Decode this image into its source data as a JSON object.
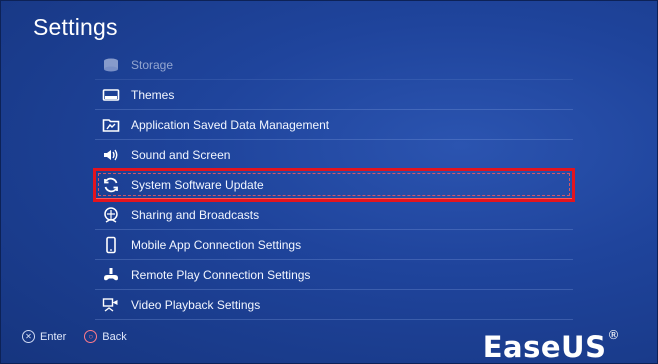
{
  "header": {
    "title": "Settings"
  },
  "menu": {
    "items": [
      {
        "label": "Storage",
        "icon": "storage-icon"
      },
      {
        "label": "Themes",
        "icon": "themes-icon"
      },
      {
        "label": "Application Saved Data Management",
        "icon": "saved-data-icon"
      },
      {
        "label": "Sound and Screen",
        "icon": "sound-screen-icon"
      },
      {
        "label": "System Software Update",
        "icon": "update-icon",
        "selected": true
      },
      {
        "label": "Sharing and Broadcasts",
        "icon": "sharing-icon"
      },
      {
        "label": "Mobile App Connection Settings",
        "icon": "mobile-icon"
      },
      {
        "label": "Remote Play Connection Settings",
        "icon": "remote-play-icon"
      },
      {
        "label": "Video Playback Settings",
        "icon": "video-playback-icon"
      }
    ]
  },
  "footer": {
    "enter_label": "Enter",
    "back_label": "Back"
  },
  "watermark": {
    "text": "EaseUS",
    "mark": "®"
  },
  "colors": {
    "background": "#1f449c",
    "highlight": "#e3141e",
    "text": "#ffffff"
  }
}
